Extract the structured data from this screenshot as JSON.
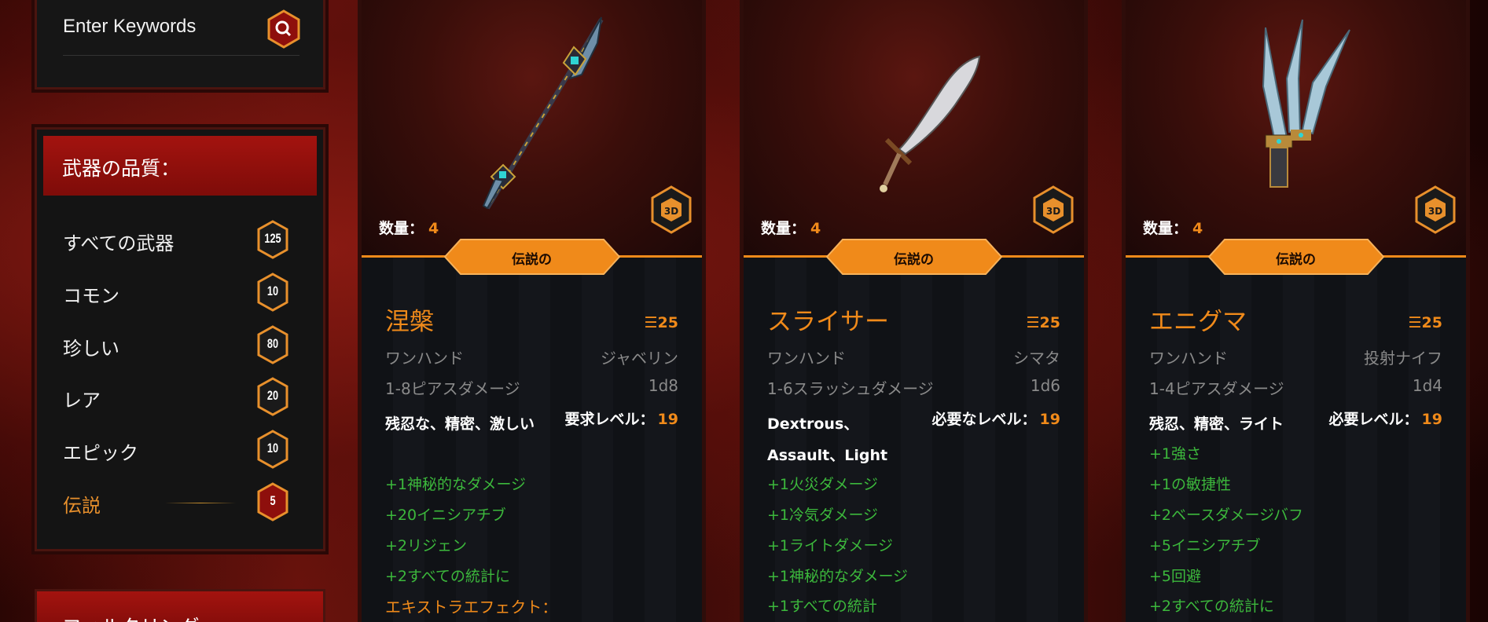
{
  "search": {
    "placeholder": "Enter Keywords"
  },
  "quality": {
    "title": "武器の品質：",
    "items": [
      {
        "label": "すべての武器",
        "count": "125",
        "active": false
      },
      {
        "label": "コモン",
        "count": "10",
        "active": false
      },
      {
        "label": "珍しい",
        "count": "80",
        "active": false
      },
      {
        "label": "レア",
        "count": "20",
        "active": false
      },
      {
        "label": "エピック",
        "count": "10",
        "active": false
      },
      {
        "label": "伝説",
        "count": "5",
        "active": true
      }
    ]
  },
  "filter": {
    "title": "フィルタリング"
  },
  "colors": {
    "accent": "#f08a1a",
    "stat_green": "#3cb83c",
    "header_red": "#a3130f"
  },
  "cards": [
    {
      "qty_label": "数量：",
      "qty_value": "4",
      "rarity": "伝説の",
      "name": "涅槃",
      "level": "☰25",
      "hand": "ワンハンド",
      "type": "ジャベリン",
      "damage_label": "1-8ピアスダメージ",
      "damage_dice": "1d8",
      "properties": "残忍な、精密、激しい",
      "req_label": "要求レベル：",
      "req_value": "19",
      "stats": [
        "+1神秘的なダメージ",
        "+20イニシアチブ",
        "+2リジェン",
        "+2すべての統計に"
      ],
      "extra": "エキストラエフェクト：",
      "icon": "javelin-icon"
    },
    {
      "qty_label": "数量：",
      "qty_value": "4",
      "rarity": "伝説の",
      "name": "スライサー",
      "level": "☰25",
      "hand": "ワンハンド",
      "type": "シマタ",
      "damage_label": "1-6スラッシュダメージ",
      "damage_dice": "1d6",
      "properties": "Dextrous、Assault、Light",
      "req_label": "必要なレベル：",
      "req_value": "19",
      "stats": [
        "+1火災ダメージ",
        "+1冷気ダメージ",
        "+1ライトダメージ",
        "+1神秘的なダメージ",
        "+1すべての統計"
      ],
      "extra": "",
      "icon": "scimitar-icon"
    },
    {
      "qty_label": "数量：",
      "qty_value": "4",
      "rarity": "伝説の",
      "name": "エニグマ",
      "level": "☰25",
      "hand": "ワンハンド",
      "type": "投射ナイフ",
      "damage_label": "1-4ピアスダメージ",
      "damage_dice": "1d4",
      "properties": "残忍、精密、ライト",
      "req_label": "必要レベル：",
      "req_value": "19",
      "stats": [
        "+1強さ",
        "+1の敏捷性",
        "+2ベースダメージバフ",
        "+5イニシアチブ",
        "+5回避",
        "+2すべての統計に"
      ],
      "extra": "",
      "icon": "throwing-knives-icon"
    }
  ]
}
